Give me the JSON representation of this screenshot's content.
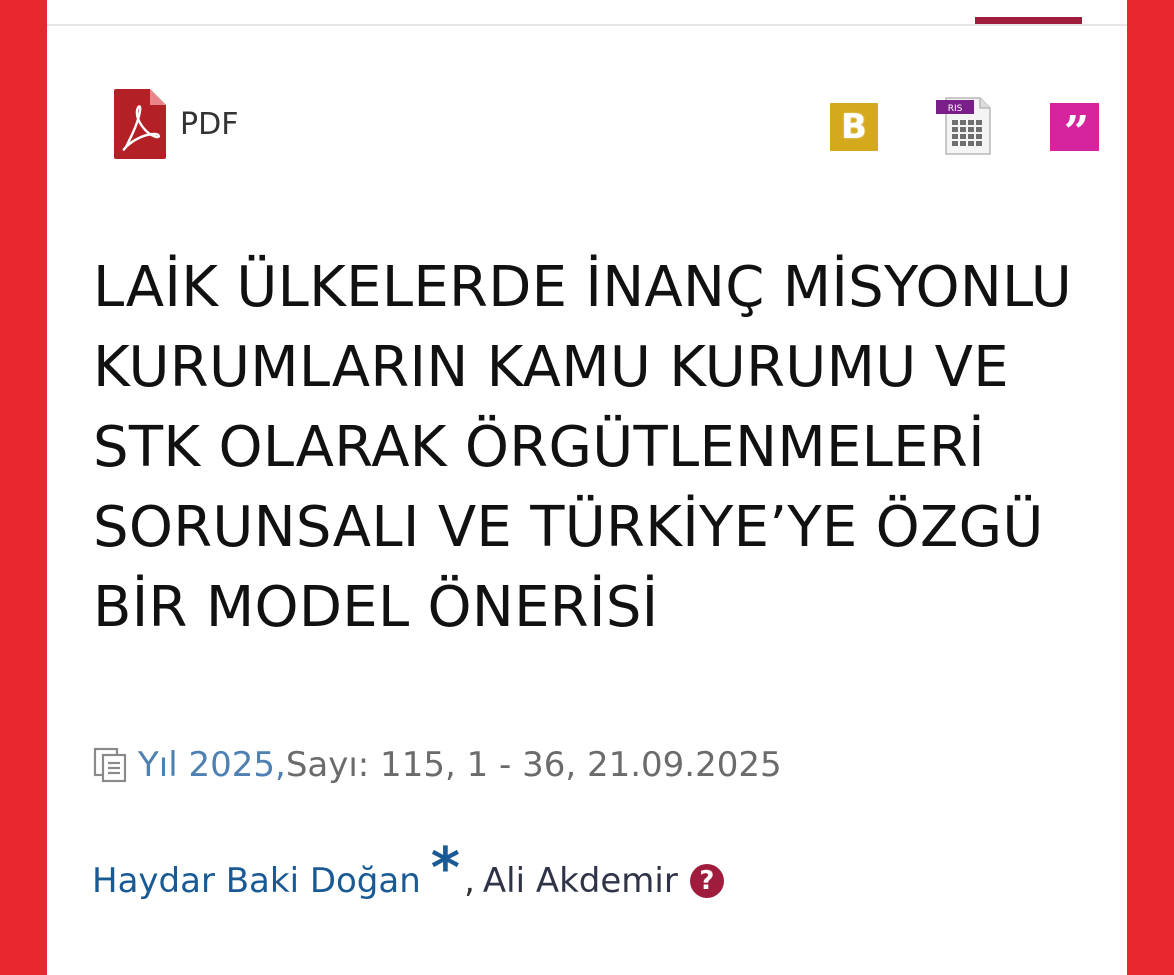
{
  "toolbar": {
    "pdf_label": "PDF",
    "pdf_icon": "pdf-file-icon",
    "bibtex_label": "B",
    "bibtex_icon": "bibtex-icon",
    "ris_label": "RIS",
    "ris_icon": "ris-file-icon",
    "cite_label": "”",
    "cite_icon": "quote-icon"
  },
  "article": {
    "title": "LAİK ÜLKELERDE İNANÇ MİSYONLU KURUMLARIN KAMU KURUMU VE STK OLARAK ÖRGÜTLENMELERİ SORUNSALI VE TÜRKİYE’YE ÖZGÜ BİR MODEL ÖNERİSİ",
    "year_link": "Yıl 2025,",
    "issue_info": " Sayı: 115, 1 - 36, 21.09.2025",
    "issue_icon": "copy-document-icon"
  },
  "authors": [
    {
      "name": "Haydar Baki Doğan",
      "marker": "*"
    },
    {
      "separator": ",",
      "name": "Ali Akdemir",
      "icon": "question-circle-icon",
      "icon_text": "?"
    }
  ],
  "colors": {
    "frame": "#e8272f",
    "accent": "#a01c3c",
    "bibtex": "#d4a91b",
    "cite": "#d6249f",
    "author_link": "#1a5a94",
    "year_link": "#4f80b2"
  }
}
